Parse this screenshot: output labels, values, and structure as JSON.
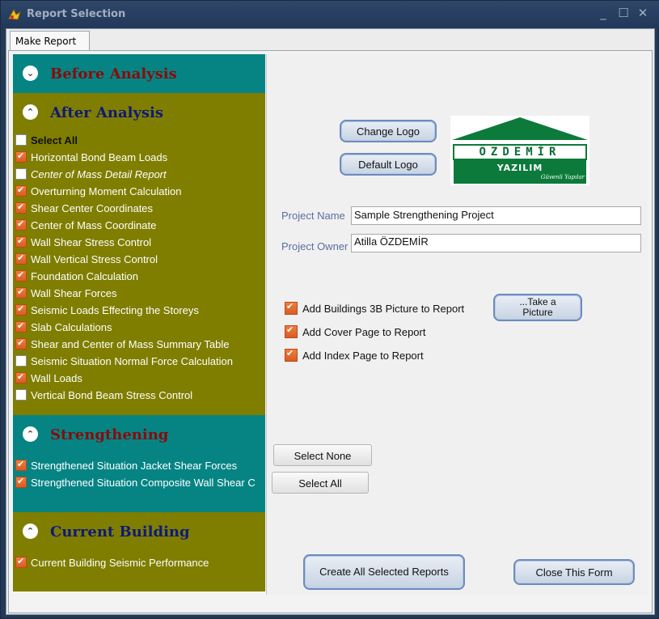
{
  "window": {
    "title": "Report Selection",
    "tab": "Make Report"
  },
  "sections": {
    "before": {
      "title": "Before Analysis"
    },
    "after": {
      "title": "After Analysis"
    },
    "strength": {
      "title": "Strengthening"
    },
    "current": {
      "title": "Current Building"
    }
  },
  "after_items": [
    {
      "label": "Select All",
      "checked": false
    },
    {
      "label": "Horizontal Bond Beam Loads",
      "checked": true
    },
    {
      "label": "Center of Mass Detail Report",
      "checked": false
    },
    {
      "label": "Overturning Moment Calculation",
      "checked": true
    },
    {
      "label": "Shear Center Coordinates",
      "checked": true
    },
    {
      "label": "Center of Mass Coordinate",
      "checked": true
    },
    {
      "label": "Wall Shear Stress Control",
      "checked": true
    },
    {
      "label": "Wall Vertical Stress Control",
      "checked": true
    },
    {
      "label": "Foundation Calculation",
      "checked": true
    },
    {
      "label": "Wall Shear Forces",
      "checked": true
    },
    {
      "label": "Seismic Loads Effecting the Storeys",
      "checked": true
    },
    {
      "label": "Slab Calculations",
      "checked": true
    },
    {
      "label": "Shear and Center of Mass Summary Table",
      "checked": true
    },
    {
      "label": "Seismic Situation Normal Force Calculation",
      "checked": false
    },
    {
      "label": "Wall Loads",
      "checked": true
    },
    {
      "label": "Vertical Bond Beam Stress Control",
      "checked": false
    }
  ],
  "strength_items": [
    {
      "label": "Strengthened Situation Jacket Shear Forces",
      "checked": true
    },
    {
      "label": "Strengthened Situation Composite Wall Shear C",
      "checked": true
    }
  ],
  "current_items": [
    {
      "label": "Current Building Seismic Performance",
      "checked": true
    }
  ],
  "buttons": {
    "change_logo": "Change Logo",
    "default_logo": "Default Logo",
    "take_picture_1": "...Take a",
    "take_picture_2": "Picture",
    "select_none": "Select None",
    "select_all": "Select All",
    "create_reports": "Create All Selected Reports",
    "close_form": "Close This Form"
  },
  "logo": {
    "name": "ÖZDEMİR",
    "sub": "YAZILIM",
    "tagline": "Güvenli Yapılar"
  },
  "project": {
    "name_label": "Project Name",
    "name_value": "Sample Strengthening Project",
    "owner_label": "Project Owner",
    "owner_value": "Atilla ÖZDEMİR"
  },
  "options": [
    {
      "label": "Add Buildings 3B Picture to Report",
      "checked": true
    },
    {
      "label": "Add Cover Page to Report",
      "checked": true
    },
    {
      "label": "Add Index Page to Report",
      "checked": true
    }
  ],
  "colors": {
    "teal": "#068484",
    "olive": "#7f7e00",
    "check": "#e06a2c"
  }
}
